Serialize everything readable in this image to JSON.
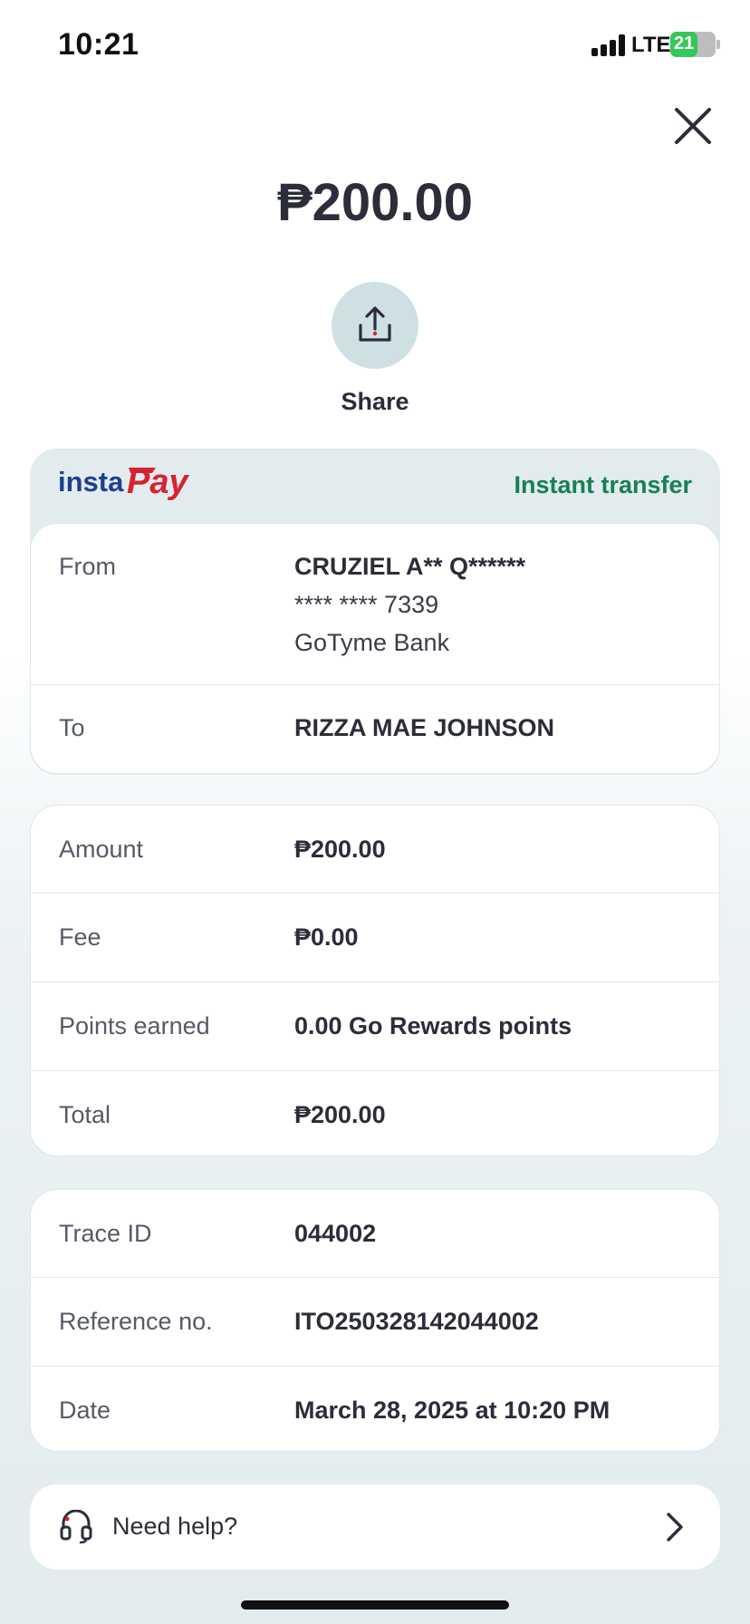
{
  "status_bar": {
    "time": "10:21",
    "network": "LTE",
    "battery": "21",
    "battery_level": 0.21
  },
  "header": {
    "amount": "₱200.00",
    "share_label": "Share"
  },
  "transfer": {
    "brand": "instaPay",
    "brand_prefix": "insta",
    "brand_suffix": "Pay",
    "type_label": "Instant transfer",
    "from_label": "From",
    "from_name": "CRUZIEL A** Q******",
    "from_account": "**** **** 7339",
    "from_bank": "GoTyme Bank",
    "to_label": "To",
    "to_name": "RIZZA MAE JOHNSON"
  },
  "amounts": {
    "amount_label": "Amount",
    "amount_value": "₱200.00",
    "fee_label": "Fee",
    "fee_value": "₱0.00",
    "points_label": "Points earned",
    "points_value": "0.00 Go Rewards points",
    "total_label": "Total",
    "total_value": "₱200.00"
  },
  "details": {
    "trace_label": "Trace ID",
    "trace_value": "044002",
    "reference_label": "Reference no.",
    "reference_value": "ITO250328142044002",
    "date_label": "Date",
    "date_value": "March 28, 2025 at 10:20 PM"
  },
  "help": {
    "label": "Need help?"
  },
  "colors": {
    "accent_green": "#178054",
    "instapay_blue": "#1d3f8f",
    "instapay_red": "#d6232f",
    "share_bg": "#cfe0e4",
    "text": "#2b2d3a"
  }
}
